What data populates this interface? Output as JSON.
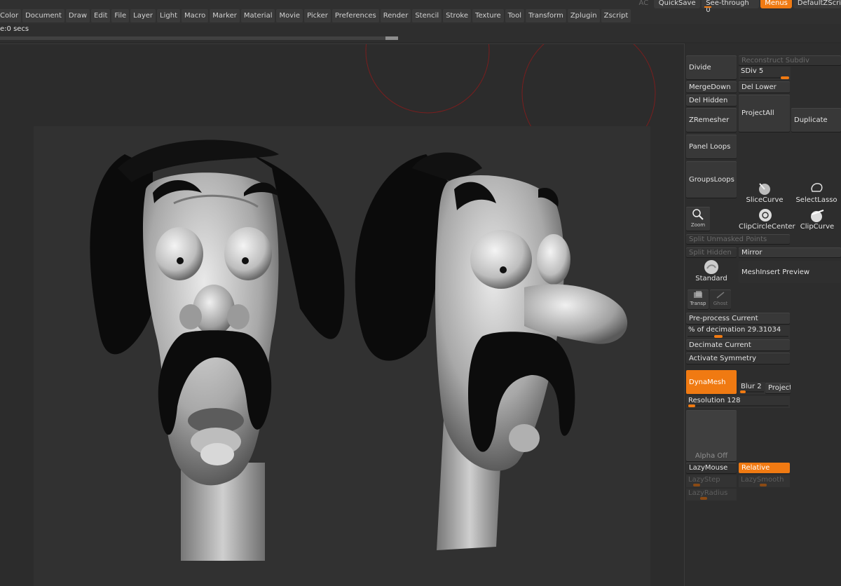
{
  "menubar": {
    "items": [
      "Color",
      "Document",
      "Draw",
      "Edit",
      "File",
      "Layer",
      "Light",
      "Macro",
      "Marker",
      "Material",
      "Movie",
      "Picker",
      "Preferences",
      "Render",
      "Stencil",
      "Stroke",
      "Texture",
      "Tool",
      "Transform",
      "Zplugin",
      "Zscript"
    ],
    "ac": "AC",
    "quicksave": "QuickSave",
    "see_through": "See-through  0",
    "menus": "Menus",
    "default_zscript": "DefaultZScri"
  },
  "status": {
    "timer": "e:0 secs"
  },
  "palette": {
    "divide": "Divide",
    "reconstruct_subdiv": "Reconstruct Subdiv",
    "sdiv": "SDiv 5",
    "sdiv_value": 5,
    "merge_down": "MergeDown",
    "del_lower": "Del Lower",
    "del_hidden": "Del Hidden",
    "zremesher": "ZRemesher",
    "project_all": "ProjectAll",
    "duplicate": "Duplicate",
    "panel_loops": "Panel Loops",
    "groups_loops": "GroupsLoops",
    "slice_curve": "SliceCurve",
    "select_lasso": "SelectLasso",
    "zoom": "Zoom",
    "clip_circle_center": "ClipCircleCenter",
    "clip_curve": "ClipCurve",
    "split_unmasked": "Split Unmasked Points",
    "split_hidden": "Split Hidden",
    "mirror": "Mirror",
    "standard": "Standard",
    "meshinsert_preview": "MeshInsert Preview",
    "transp": "Transp",
    "ghost": "Ghost",
    "preprocess_current": "Pre-process Current",
    "decimation_label": "% of decimation",
    "decimation_value": "29.31034",
    "decimate_current": "Decimate Current",
    "activate_symmetry": "Activate Symmetry",
    "dynamesh": "DynaMesh",
    "blur": "Blur 2",
    "project": "Project",
    "resolution": "Resolution 128",
    "alpha_off": "Alpha Off",
    "lazymouse": "LazyMouse",
    "relative": "Relative",
    "lazystep": "LazyStep",
    "lazysmooth": "LazySmooth",
    "lazyradius": "LazyRadius"
  }
}
